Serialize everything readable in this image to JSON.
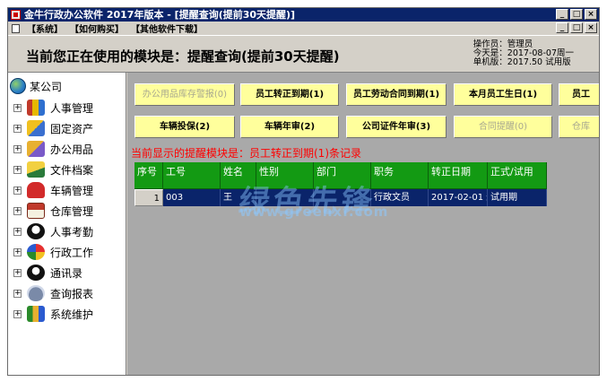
{
  "window": {
    "title": "金牛行政办公软件 2017年版本 - [提醒查询(提前30天提醒)]",
    "controls": [
      "_",
      "□",
      "×"
    ]
  },
  "menu": {
    "items": [
      "【系统】",
      "【如何购买】",
      "【其他软件下载】"
    ],
    "mdi_controls": [
      "_",
      "□",
      "×"
    ]
  },
  "header": {
    "module_title": "当前您正在使用的模块是：提醒查询(提前30天提醒)",
    "operator": "操作员：管理员",
    "today": "今天是：2017-08-07周一",
    "edition": "单机版：2017.50 试用版"
  },
  "tree": {
    "root": "某公司",
    "items": [
      {
        "label": "人事管理",
        "icon": "people-icon"
      },
      {
        "label": "固定资产",
        "icon": "assets-icon"
      },
      {
        "label": "办公用品",
        "icon": "office-supplies-icon"
      },
      {
        "label": "文件档案",
        "icon": "files-icon"
      },
      {
        "label": "车辆管理",
        "icon": "car-icon"
      },
      {
        "label": "仓库管理",
        "icon": "warehouse-icon"
      },
      {
        "label": "人事考勤",
        "icon": "attendance-icon"
      },
      {
        "label": "行政工作",
        "icon": "admin-work-icon"
      },
      {
        "label": "通讯录",
        "icon": "contacts-icon"
      },
      {
        "label": "查询报表",
        "icon": "report-icon"
      },
      {
        "label": "系统维护",
        "icon": "maintenance-icon"
      }
    ]
  },
  "reminders": {
    "row1": [
      "办公用品库存警报(0)",
      "员工转正到期(1)",
      "员工劳动合同到期(1)",
      "本月员工生日(1)",
      "员工"
    ],
    "row2": [
      "车辆投保(2)",
      "车辆年审(2)",
      "公司证件年审(3)",
      "合同提醒(0)",
      "仓库"
    ]
  },
  "notice": "当前显示的提醒模块是：员工转正到期(1)条记录",
  "table": {
    "columns": [
      "序号",
      "工号",
      "姓名",
      "性别",
      "部门",
      "职务",
      "转正日期",
      "正式/试用"
    ],
    "rows": [
      [
        "1",
        "003",
        "王",
        "",
        "",
        "行政文员",
        "2017-02-01 过",
        "试用期"
      ]
    ]
  },
  "watermark": {
    "main": "绿色先锋",
    "sub": "www.greenxf.com"
  },
  "colors": {
    "title_bar": "#0a246a",
    "tile_bg": "#ffff9c",
    "grid_header": "#139a13",
    "selected_row": "#0a246a",
    "notice": "#ff0000",
    "content_bg": "#a9a9a9"
  }
}
